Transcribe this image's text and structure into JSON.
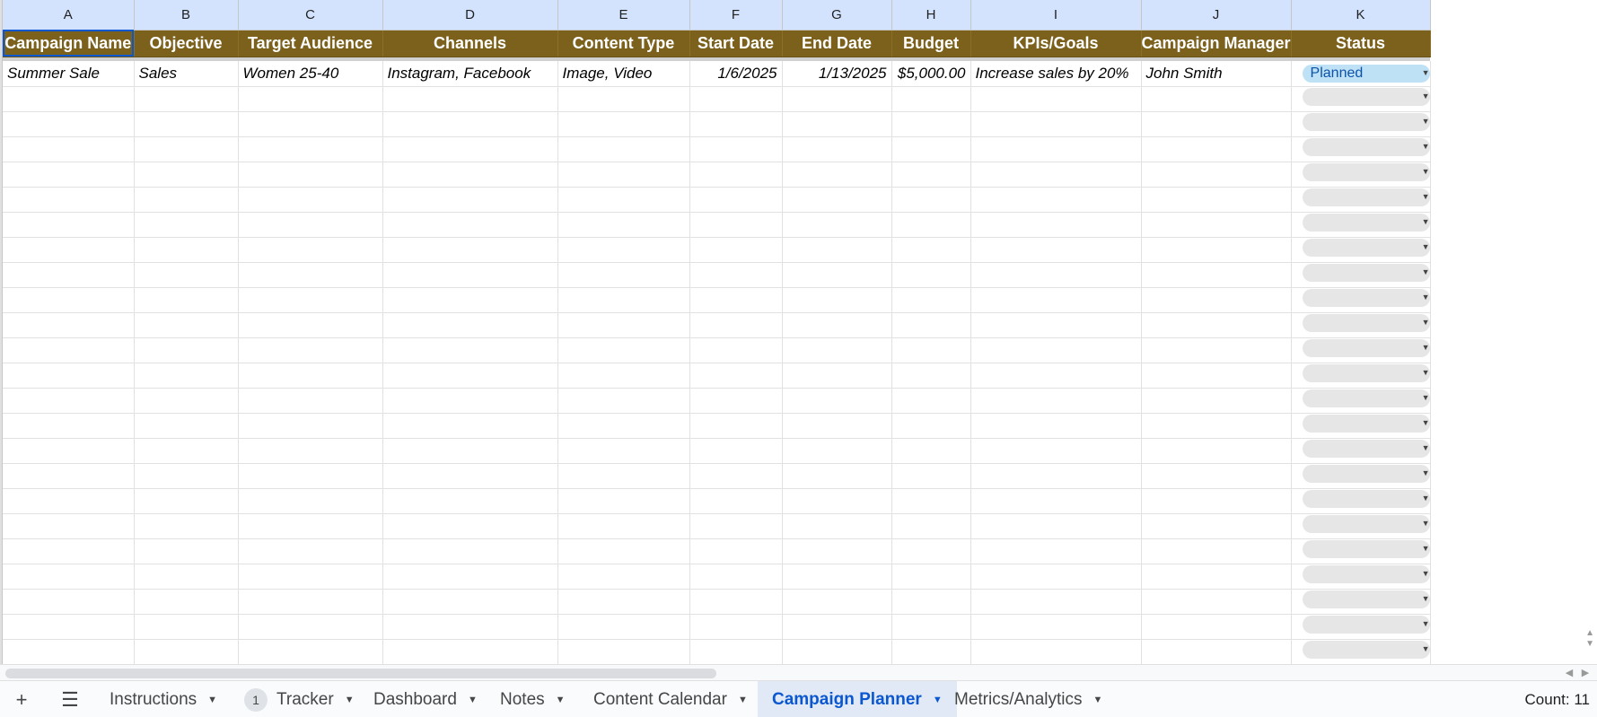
{
  "columns": [
    "A",
    "B",
    "C",
    "D",
    "E",
    "F",
    "G",
    "H",
    "I",
    "J",
    "K"
  ],
  "headers": [
    "Campaign Name",
    "Objective",
    "Target Audience",
    "Channels",
    "Content Type",
    "Start Date",
    "End Date",
    "Budget",
    "KPIs/Goals",
    "Campaign Manager",
    "Status"
  ],
  "rows": [
    {
      "campaign_name": "Summer Sale",
      "objective": "Sales",
      "target_audience": "Women 25-40",
      "channels": "Instagram, Facebook",
      "content_type": "Image, Video",
      "start_date": "1/6/2025",
      "end_date": "1/13/2025",
      "budget": "$5,000.00",
      "kpis": "Increase sales by 20%",
      "manager": "John Smith",
      "status": "Planned"
    }
  ],
  "empty_rows": 23,
  "status_colors": {
    "planned_bg": "#bfe1f6",
    "planned_text": "#0a53a8",
    "empty_bg": "#e6e6e6"
  },
  "header_color": "#7b611c",
  "sheets": [
    {
      "name": "Instructions",
      "badge": null,
      "active": false
    },
    {
      "name": "Tracker",
      "badge": "1",
      "active": false
    },
    {
      "name": "Dashboard",
      "badge": null,
      "active": false
    },
    {
      "name": "Notes",
      "badge": null,
      "active": false
    },
    {
      "name": "Content Calendar",
      "badge": null,
      "active": false
    },
    {
      "name": "Campaign Planner",
      "badge": null,
      "active": true
    },
    {
      "name": "Metrics/Analytics",
      "badge": null,
      "active": false
    }
  ],
  "status_bar": {
    "count_label": "Count: 11"
  },
  "icons": {
    "add_sheet": "plus-icon",
    "all_sheets": "menu-icon",
    "tab_dropdown": "caret-down-icon"
  }
}
